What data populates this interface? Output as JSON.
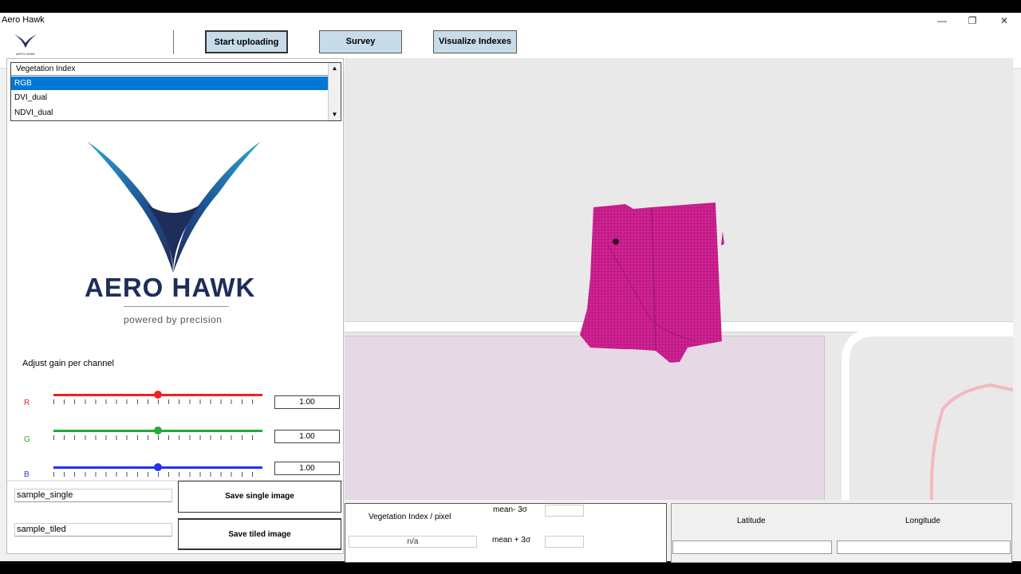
{
  "window": {
    "title": "Aero Hawk"
  },
  "toolbar": {
    "logo_text": "AERO HAWK",
    "buttons": [
      "Start uploading",
      "Survey",
      "Visualize Indexes"
    ]
  },
  "vegetation_list": {
    "header": "Vegetation Index",
    "items": [
      "RGB",
      "DVI_dual",
      "NDVI_dual"
    ],
    "selected": "RGB"
  },
  "branding": {
    "name": "AERO HAWK",
    "tagline": "powered by precision",
    "colors": {
      "wing_dark": "#1e2d5a",
      "wing_light": "#2aa8d8"
    }
  },
  "gain": {
    "label": "Adjust gain per channel",
    "channels": [
      {
        "name": "R",
        "value": "1.00",
        "level": 0.5,
        "color": "#ee2222"
      },
      {
        "name": "G",
        "value": "1.00",
        "level": 0.5,
        "color": "#22aa33"
      },
      {
        "name": "B",
        "value": "1.00",
        "level": 0.5,
        "color": "#2233ee"
      }
    ]
  },
  "save": {
    "single_name": "sample_single",
    "single_button": "Save single image",
    "tiled_name": "sample_tiled",
    "tiled_button": "Save tiled image"
  },
  "stats": {
    "index_label": "Vegetation Index / pixel",
    "index_value": "n/a",
    "mean_minus": "mean- 3σ",
    "mean_plus": "mean + 3σ",
    "mean_minus_value": "",
    "mean_plus_value": ""
  },
  "coords": {
    "latitude_label": "Latitude",
    "longitude_label": "Longitude",
    "latitude_value": "",
    "longitude_value": ""
  },
  "map": {
    "overlay_color": "#c81e8c"
  }
}
